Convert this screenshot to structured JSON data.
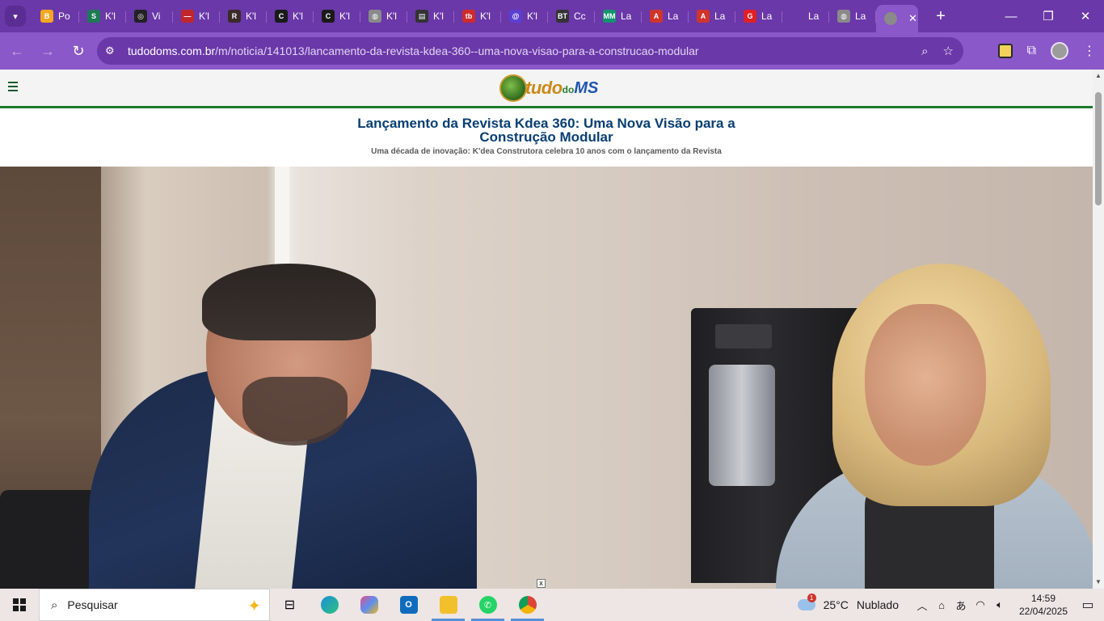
{
  "browser": {
    "tabs": [
      {
        "title": "Po",
        "favicon_color": "#f4a622",
        "favicon_glyph": "B"
      },
      {
        "title": "K'l",
        "favicon_color": "#1d7a55",
        "favicon_glyph": "S"
      },
      {
        "title": "Vi",
        "favicon_color": "#222222",
        "favicon_glyph": "◎"
      },
      {
        "title": "K'l",
        "favicon_color": "#c0262d",
        "favicon_glyph": "—"
      },
      {
        "title": "K'l",
        "favicon_color": "#3a2a2a",
        "favicon_glyph": "R"
      },
      {
        "title": "K'l",
        "favicon_color": "#1a1a1a",
        "favicon_glyph": "C"
      },
      {
        "title": "K'l",
        "favicon_color": "#1a1a1a",
        "favicon_glyph": "C"
      },
      {
        "title": "K'l",
        "favicon_color": "#8a8a8a",
        "favicon_glyph": "◍"
      },
      {
        "title": "K'l",
        "favicon_color": "#333333",
        "favicon_glyph": "▤"
      },
      {
        "title": "K'l",
        "favicon_color": "#d02b2b",
        "favicon_glyph": "tb"
      },
      {
        "title": "K'l",
        "favicon_color": "#5b3fd1",
        "favicon_glyph": "@"
      },
      {
        "title": "Cc",
        "favicon_color": "#333333",
        "favicon_glyph": "BT"
      },
      {
        "title": "La",
        "favicon_color": "#12946f",
        "favicon_glyph": "MM"
      },
      {
        "title": "La",
        "favicon_color": "#d0342c",
        "favicon_glyph": "A"
      },
      {
        "title": "La",
        "favicon_color": "#d0342c",
        "favicon_glyph": "A"
      },
      {
        "title": "La",
        "favicon_color": "#e01f26",
        "favicon_glyph": "G"
      },
      {
        "title": "La",
        "favicon_color": "#6a38a8",
        "favicon_glyph": ""
      },
      {
        "title": "La",
        "favicon_color": "#8a8a8a",
        "favicon_glyph": "◍"
      }
    ],
    "active_tab_close": "✕",
    "new_tab": "+",
    "window_controls": {
      "minimize": "—",
      "maximize": "❐",
      "close": "✕"
    },
    "url_host": "tudodoms.com.br",
    "url_path": "/m/noticia/141013/lancamento-da-revista-kdea-360--uma-nova-visao-para-a-construcao-modular",
    "icons": [
      "back-icon",
      "forward-icon",
      "reload-icon",
      "site-info-icon",
      "zoom-icon",
      "bookmark-star-icon",
      "extension-icon",
      "puzzle-icon",
      "profile-avatar",
      "menu-kebab-icon"
    ],
    "accent": "#6a38a8"
  },
  "site": {
    "logo": {
      "part1": "tudo",
      "part2": "do",
      "part3": "MS"
    },
    "brand_green": "#1c7a2d"
  },
  "article": {
    "title": "Lançamento da Revista Kdea 360: Uma Nova Visão para a Construção Modular",
    "subtitle": "Uma década de inovação: K'dea Construtora celebra 10 anos com o lançamento da Revista",
    "ad_close": "x"
  },
  "taskbar": {
    "search_label": "Pesquisar",
    "weather_temp": "25°C",
    "weather_desc": "Nublado",
    "weather_badge": "1",
    "time": "14:59",
    "date": "22/04/2025",
    "apps": [
      "task-view-icon",
      "edge-icon",
      "copilot-icon",
      "outlook-icon",
      "file-explorer-icon",
      "whatsapp-icon",
      "chrome-icon"
    ]
  }
}
